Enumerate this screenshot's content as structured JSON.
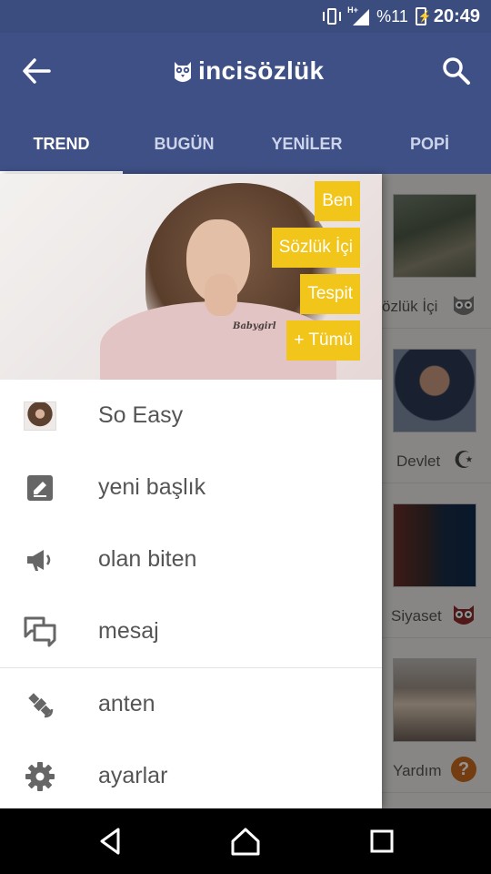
{
  "status_bar": {
    "network_type": "H+",
    "battery_percent": "%11",
    "time": "20:49",
    "icons": [
      "vibrate-icon",
      "signal-icon",
      "battery-charging-icon"
    ]
  },
  "app_bar": {
    "logo_text": "incisözlük",
    "tabs": [
      {
        "label": "TREND",
        "active": true
      },
      {
        "label": "BUGÜN",
        "active": false
      },
      {
        "label": "YENİLER",
        "active": false
      },
      {
        "label": "POPİ",
        "active": false
      }
    ]
  },
  "drawer": {
    "header_buttons": [
      "Ben",
      "Sözlük İçi",
      "Tespit",
      "+ Tümü"
    ],
    "header_photo_print": "Babygirl",
    "menu_items": [
      {
        "label": "So Easy",
        "icon": "avatar"
      },
      {
        "label": "yeni başlık",
        "icon": "edit-icon"
      },
      {
        "label": "olan biten",
        "icon": "megaphone-icon"
      },
      {
        "label": "mesaj",
        "icon": "chat-icon"
      },
      {
        "label": "anten",
        "icon": "satellite-icon"
      },
      {
        "label": "ayarlar",
        "icon": "gear-icon"
      }
    ]
  },
  "feed": {
    "items": [
      {
        "label": "özlük İçi",
        "badge": "owl-icon"
      },
      {
        "label": "Devlet",
        "badge": "crescent-star-icon"
      },
      {
        "label": "Siyaset",
        "badge": "owl-red-icon"
      },
      {
        "label": "Yardım",
        "badge": "question-icon"
      }
    ]
  },
  "colors": {
    "primary": "#3e5085",
    "status_bar": "#3b4d7f",
    "accent_yellow": "#f2c51a",
    "nav_bar": "#000000"
  }
}
